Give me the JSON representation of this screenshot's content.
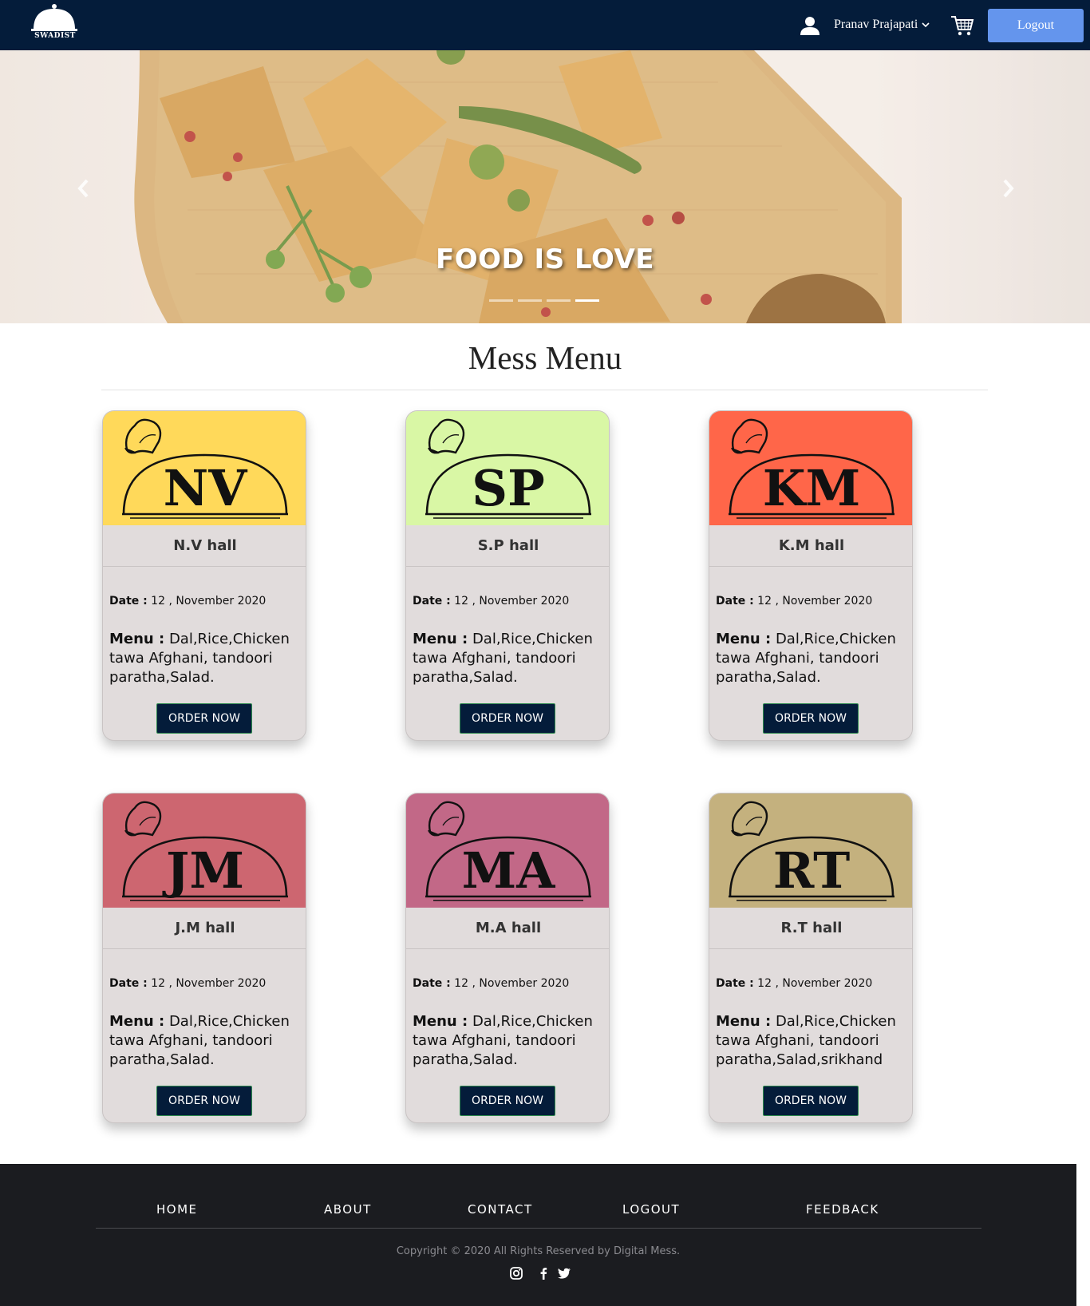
{
  "navbar": {
    "logo_text": "SWADIST",
    "user_name": "Pranav Prajapati",
    "logout_label": "Logout"
  },
  "hero": {
    "caption": "FOOD IS LOVE",
    "slide_count": 4,
    "active_slide": 4
  },
  "section": {
    "title": "Mess Menu"
  },
  "cards": [
    {
      "abbr": "NV",
      "title": "N.V hall",
      "date_label": "Date :",
      "date": " 12 , November 2020",
      "menu_label": "Menu :",
      "menu": " Dal,Rice,Chicken tawa Afghani, tandoori paratha,Salad.",
      "button": "ORDER NOW",
      "color": "#ffd95a"
    },
    {
      "abbr": "SP",
      "title": "S.P hall",
      "date_label": "Date :",
      "date": " 12 , November 2020",
      "menu_label": "Menu :",
      "menu": " Dal,Rice,Chicken tawa Afghani, tandoori paratha,Salad.",
      "button": "ORDER NOW",
      "color": "#d9f7a5"
    },
    {
      "abbr": "KM",
      "title": "K.M hall",
      "date_label": "Date :",
      "date": " 12 , November 2020",
      "menu_label": "Menu :",
      "menu": " Dal,Rice,Chicken tawa Afghani, tandoori paratha,Salad.",
      "button": "ORDER NOW",
      "color": "#ff6649"
    },
    {
      "abbr": "JM",
      "title": "J.M hall",
      "date_label": "Date :",
      "date": " 12 , November 2020",
      "menu_label": "Menu :",
      "menu": " Dal,Rice,Chicken tawa Afghani, tandoori paratha,Salad.",
      "button": "ORDER NOW",
      "color": "#cd6670"
    },
    {
      "abbr": "MA",
      "title": "M.A hall",
      "date_label": "Date :",
      "date": " 12 , November 2020",
      "menu_label": "Menu :",
      "menu": " Dal,Rice,Chicken tawa Afghani, tandoori paratha,Salad.",
      "button": "ORDER NOW",
      "color": "#c26887"
    },
    {
      "abbr": "RT",
      "title": "R.T hall",
      "date_label": "Date :",
      "date": " 12 , November 2020",
      "menu_label": "Menu :",
      "menu": " Dal,Rice,Chicken tawa Afghani, tandoori paratha,Salad,srikhand",
      "button": "ORDER NOW",
      "color": "#c4b17e"
    }
  ],
  "footer": {
    "links": [
      "HOME",
      "ABOUT",
      "CONTACT",
      "LOGOUT",
      "FEEDBACK"
    ],
    "copyright": "Copyright © 2020 All Rights Reserved by Digital Mess.",
    "social": [
      "instagram-icon",
      "facebook-icon",
      "twitter-icon"
    ]
  }
}
